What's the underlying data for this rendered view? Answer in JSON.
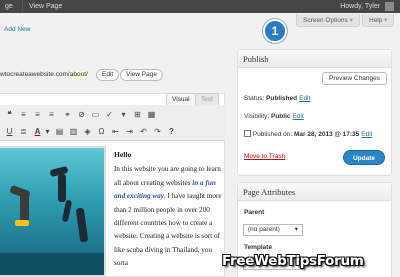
{
  "adminbar": {
    "item1": "ge",
    "view_page": "View Page",
    "howdy": "Howdy, Tyler"
  },
  "screen_options": {
    "label": "Screen Options",
    "help": "Help"
  },
  "step_badge": "1",
  "add_new": "Add New",
  "permalink": {
    "prefix": "wtocreateawebsite.com/",
    "slug": "about",
    "suffix": "/",
    "edit_label": "Edit",
    "view_label": "View Page"
  },
  "editor": {
    "tab_visual": "Visual",
    "tab_text": "Text",
    "toolbar_icons": [
      "quote-icon",
      "align-left-icon",
      "align-center-icon",
      "align-right-icon",
      "link-icon",
      "unlink-icon",
      "insert-more-icon",
      "spellcheck-icon",
      "fullscreen-icon",
      "kitchen-sink-icon",
      "underline-icon",
      "justify-icon",
      "text-color-icon",
      "paste-text-icon",
      "paste-word-icon",
      "clear-formatting-icon",
      "special-char-icon",
      "outdent-icon",
      "indent-icon",
      "undo-icon",
      "redo-icon",
      "help-icon"
    ],
    "heading": "Hello",
    "p1": "In this website you are going to learn all about creating websites",
    "p1_link": "in a fun and exciting way",
    "p1_rest": ".  I have taught more than 2 million people in over 200 different countries how to create a website.  Creating a website is sort of like scuba diving in Thailand, you sorta"
  },
  "publish": {
    "title": "Publish",
    "preview_label": "Preview Changes",
    "status_label": "Status:",
    "status_value": "Published",
    "visibility_label": "Visibility:",
    "visibility_value": "Public",
    "published_label": "Published on:",
    "published_value": "Mar 28, 2013 @ 17:35",
    "edit_label": "Edit",
    "trash_label": "Move to Trash",
    "update_label": "Update"
  },
  "page_attributes": {
    "title": "Page Attributes",
    "parent_label": "Parent",
    "parent_value": "(no parent)",
    "template_label": "Template"
  },
  "watermark": "FreeWebTipsForum"
}
